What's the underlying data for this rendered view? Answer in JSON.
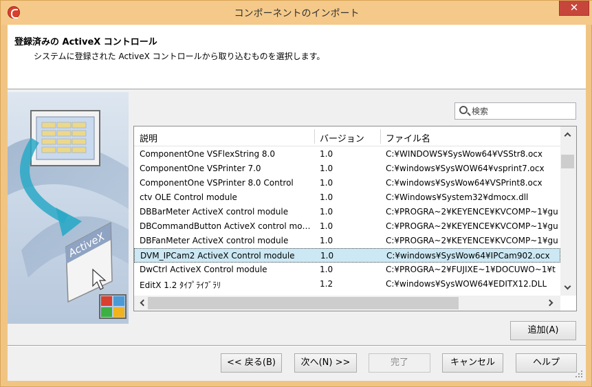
{
  "window": {
    "title": "コンポーネントのインポート",
    "close_label": "✕"
  },
  "header": {
    "title": "登録済みの ActiveX コントロール",
    "description": "システムに登録された ActiveX コントロールから取り込むものを選択します。"
  },
  "illustration": {
    "label": "ActiveX"
  },
  "search": {
    "placeholder": "検索"
  },
  "table": {
    "columns": [
      "説明",
      "バージョン",
      "ファイル名"
    ],
    "rows": [
      {
        "desc": "ComponentOne VSFlexString 8.0",
        "ver": "1.0",
        "file": "C:¥WINDOWS¥SysWow64¥VSStr8.ocx"
      },
      {
        "desc": "ComponentOne VSPrinter 7.0",
        "ver": "1.0",
        "file": "C:¥windows¥SysWOW64¥vsprint7.ocx"
      },
      {
        "desc": "ComponentOne VSPrinter 8.0 Control",
        "ver": "1.0",
        "file": "C:¥windows¥SysWow64¥VSPrint8.ocx"
      },
      {
        "desc": "ctv OLE Control module",
        "ver": "1.0",
        "file": "C:¥Windows¥System32¥dmocx.dll"
      },
      {
        "desc": "DBBarMeter ActiveX control module",
        "ver": "1.0",
        "file": "C:¥PROGRA~2¥KEYENCE¥KVCOMP~1¥gu"
      },
      {
        "desc": "DBCommandButton ActiveX control mo…",
        "ver": "1.0",
        "file": "C:¥PROGRA~2¥KEYENCE¥KVCOMP~1¥gu"
      },
      {
        "desc": "DBFanMeter ActiveX control module",
        "ver": "1.0",
        "file": "C:¥PROGRA~2¥KEYENCE¥KVCOMP~1¥gu"
      },
      {
        "desc": "DVM_IPCam2 ActiveX Control module",
        "ver": "1.0",
        "file": "C:¥windows¥SysWow64¥IPCam902.ocx"
      },
      {
        "desc": "DwCtrl ActiveX Control module",
        "ver": "1.0",
        "file": "C:¥PROGRA~2¥FUJIXE~1¥DOCUWO~1¥t"
      },
      {
        "desc": "EditX 1.2 ﾀｲﾌﾟﾗｲﾌﾞﾗﾘ",
        "ver": "1.2",
        "file": "C:¥windows¥SysWOW64¥EDITX12.DLL"
      }
    ],
    "selected_index": 7
  },
  "buttons": {
    "add": "追加(A)",
    "back": "<< 戻る(B)",
    "next": "次へ(N) >>",
    "finish": "完了",
    "cancel": "キャンセル",
    "help": "ヘルプ"
  },
  "colors": {
    "titlebar": "#f4c98a",
    "close": "#c7463c",
    "selection": "#cce8f4"
  }
}
